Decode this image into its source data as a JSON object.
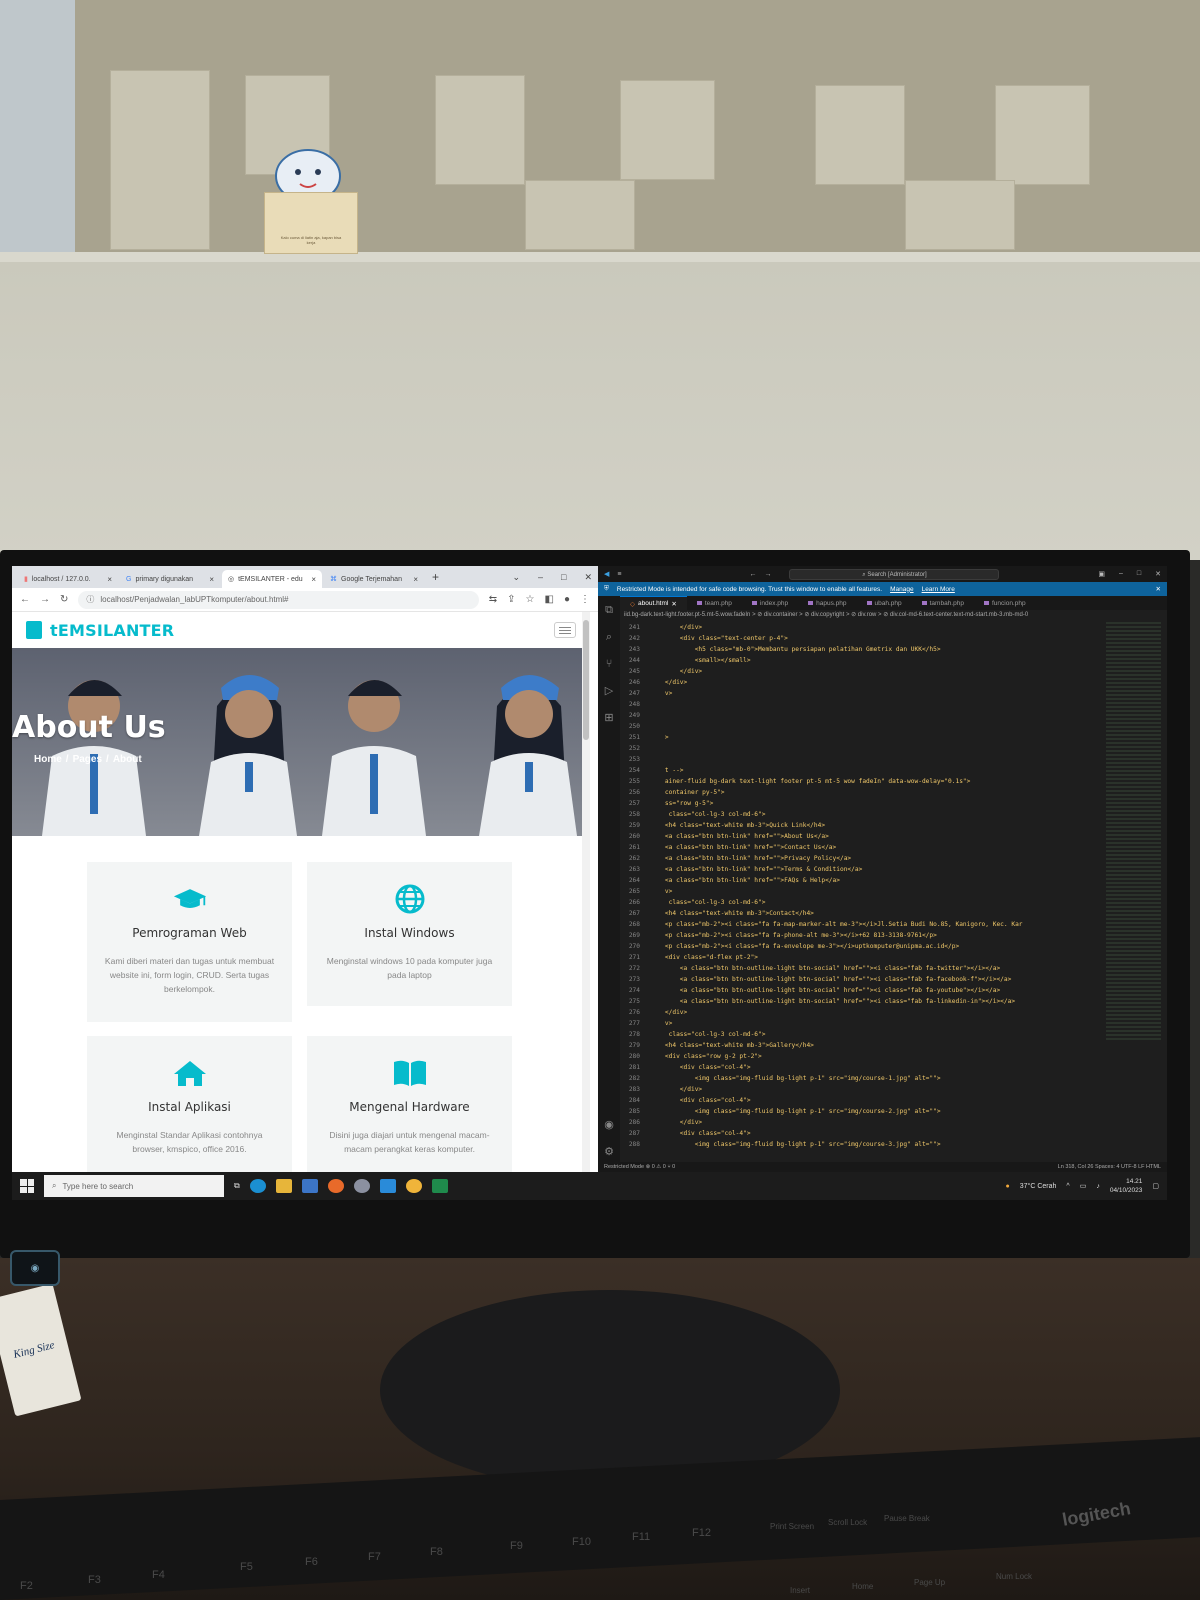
{
  "browser": {
    "tabs": [
      {
        "label": "localhost / 127.0.0."
      },
      {
        "label": "primary digunakan"
      },
      {
        "label": "tEMSILANTER - edu"
      },
      {
        "label": "Google Terjemahan"
      }
    ],
    "url": "localhost/Penjadwalan_labUPTkomputer/about.html#"
  },
  "site": {
    "brand": "tEMSILANTER",
    "hero_title": "About Us",
    "breadcrumb": [
      "Home",
      "/",
      "Pages",
      "/",
      "About"
    ],
    "services": [
      {
        "title": "Pemrograman Web",
        "icon": "graduation-cap-icon",
        "desc": "Kami diberi materi dan tugas untuk membuat website ini, form login, CRUD. Serta tugas berkelompok."
      },
      {
        "title": "Instal Windows",
        "icon": "globe-icon",
        "desc": "Menginstal windows 10 pada komputer juga pada laptop"
      },
      {
        "title": "Instal Aplikasi",
        "icon": "home-icon",
        "desc": "Menginstal Standar Aplikasi contohnya browser, kmspico, office 2016."
      },
      {
        "title": "Mengenal Hardware",
        "icon": "book-open-icon",
        "desc": "Disini juga diajari untuk mengenal macam-macam perangkat keras komputer."
      }
    ],
    "accent": "#06bbcc"
  },
  "vscode": {
    "search": "Search [Administrator]",
    "restricted_msg": "Restricted Mode is intended for safe code browsing. Trust this window to enable all features.",
    "manage": "Manage",
    "learn_more": "Learn More",
    "tabs": [
      "about.html",
      "team.php",
      "index.php",
      "hapus.php",
      "ubah.php",
      "tambah.php",
      "funcion.php"
    ],
    "breadcrumb": "iid.bg-dark.text-light.footer.pt-5.mt-5.wow.fadeIn > ⊘ div.container > ⊘ div.copyright > ⊘ div.row > ⊘ div.col-md-6.text-center.text-md-start.mb-3.mb-md-0",
    "lines": [
      {
        "n": "241",
        "t": "        </div>"
      },
      {
        "n": "242",
        "t": "        <div class=\"text-center p-4\">"
      },
      {
        "n": "243",
        "t": "            <h5 class=\"mb-0\">Membantu persiapan pelatihan Gmetrix dan UKK</h5>"
      },
      {
        "n": "244",
        "t": "            <small></small>"
      },
      {
        "n": "245",
        "t": "        </div>"
      },
      {
        "n": "246",
        "t": "    </div>"
      },
      {
        "n": "247",
        "t": "    v>"
      },
      {
        "n": "248",
        "t": ""
      },
      {
        "n": "249",
        "t": ""
      },
      {
        "n": "250",
        "t": ""
      },
      {
        "n": "251",
        "t": "    >"
      },
      {
        "n": "252",
        "t": ""
      },
      {
        "n": "253",
        "t": ""
      },
      {
        "n": "254",
        "t": "    t -->"
      },
      {
        "n": "255",
        "t": "    ainer-fluid bg-dark text-light footer pt-5 mt-5 wow fadeIn\" data-wow-delay=\"0.1s\">"
      },
      {
        "n": "256",
        "t": "    container py-5\">"
      },
      {
        "n": "257",
        "t": "    ss=\"row g-5\">"
      },
      {
        "n": "258",
        "t": "     class=\"col-lg-3 col-md-6\">"
      },
      {
        "n": "259",
        "t": "    <h4 class=\"text-white mb-3\">Quick Link</h4>"
      },
      {
        "n": "260",
        "t": "    <a class=\"btn btn-link\" href=\"\">About Us</a>"
      },
      {
        "n": "261",
        "t": "    <a class=\"btn btn-link\" href=\"\">Contact Us</a>"
      },
      {
        "n": "262",
        "t": "    <a class=\"btn btn-link\" href=\"\">Privacy Policy</a>"
      },
      {
        "n": "263",
        "t": "    <a class=\"btn btn-link\" href=\"\">Terms & Condition</a>"
      },
      {
        "n": "264",
        "t": "    <a class=\"btn btn-link\" href=\"\">FAQs & Help</a>"
      },
      {
        "n": "265",
        "t": "    v>"
      },
      {
        "n": "266",
        "t": "     class=\"col-lg-3 col-md-6\">"
      },
      {
        "n": "267",
        "t": "    <h4 class=\"text-white mb-3\">Contact</h4>"
      },
      {
        "n": "268",
        "t": "    <p class=\"mb-2\"><i class=\"fa fa-map-marker-alt me-3\"></i>Jl.Setia Budi No.85, Kanigoro, Kec. Kar"
      },
      {
        "n": "269",
        "t": "    <p class=\"mb-2\"><i class=\"fa fa-phone-alt me-3\"></i>+62 813-3138-9761</p>"
      },
      {
        "n": "270",
        "t": "    <p class=\"mb-2\"><i class=\"fa fa-envelope me-3\"></i>uptkomputer@unipma.ac.id</p>"
      },
      {
        "n": "271",
        "t": "    <div class=\"d-flex pt-2\">"
      },
      {
        "n": "272",
        "t": "        <a class=\"btn btn-outline-light btn-social\" href=\"\"><i class=\"fab fa-twitter\"></i></a>"
      },
      {
        "n": "273",
        "t": "        <a class=\"btn btn-outline-light btn-social\" href=\"\"><i class=\"fab fa-facebook-f\"></i></a>"
      },
      {
        "n": "274",
        "t": "        <a class=\"btn btn-outline-light btn-social\" href=\"\"><i class=\"fab fa-youtube\"></i></a>"
      },
      {
        "n": "275",
        "t": "        <a class=\"btn btn-outline-light btn-social\" href=\"\"><i class=\"fab fa-linkedin-in\"></i></a>"
      },
      {
        "n": "276",
        "t": "    </div>"
      },
      {
        "n": "277",
        "t": "    v>"
      },
      {
        "n": "278",
        "t": "     class=\"col-lg-3 col-md-6\">"
      },
      {
        "n": "279",
        "t": "    <h4 class=\"text-white mb-3\">Gallery</h4>"
      },
      {
        "n": "280",
        "t": "    <div class=\"row g-2 pt-2\">"
      },
      {
        "n": "281",
        "t": "        <div class=\"col-4\">"
      },
      {
        "n": "282",
        "t": "            <img class=\"img-fluid bg-light p-1\" src=\"img/course-1.jpg\" alt=\"\">"
      },
      {
        "n": "283",
        "t": "        </div>"
      },
      {
        "n": "284",
        "t": "        <div class=\"col-4\">"
      },
      {
        "n": "285",
        "t": "            <img class=\"img-fluid bg-light p-1\" src=\"img/course-2.jpg\" alt=\"\">"
      },
      {
        "n": "286",
        "t": "        </div>"
      },
      {
        "n": "287",
        "t": "        <div class=\"col-4\">"
      },
      {
        "n": "288",
        "t": "            <img class=\"img-fluid bg-light p-1\" src=\"img/course-3.jpg\" alt=\"\">"
      }
    ],
    "status_left": "Restricted Mode   ⊗ 0 ⚠ 0   ⑂ 0",
    "status_right": "Ln 318, Col 26   Spaces: 4   UTF-8   LF   HTML"
  },
  "taskbar": {
    "search_placeholder": "Type here to search",
    "weather": "37°C  Cerah",
    "time": "14.21",
    "date": "04/10/2023"
  },
  "room": {
    "sticky_note": "Kalo cuma di liatin aja, kapan bisa kerja",
    "keyboard_brand": "logitech",
    "pack_text": "King Size",
    "fkeys": [
      "F2",
      "F3",
      "F4",
      "F5",
      "F6",
      "F7",
      "F8",
      "F9",
      "F10",
      "F11",
      "F12",
      "Print Screen",
      "Scroll Lock",
      "Pause Break",
      "Insert",
      "Home",
      "Page Up",
      "Num Lock"
    ]
  }
}
